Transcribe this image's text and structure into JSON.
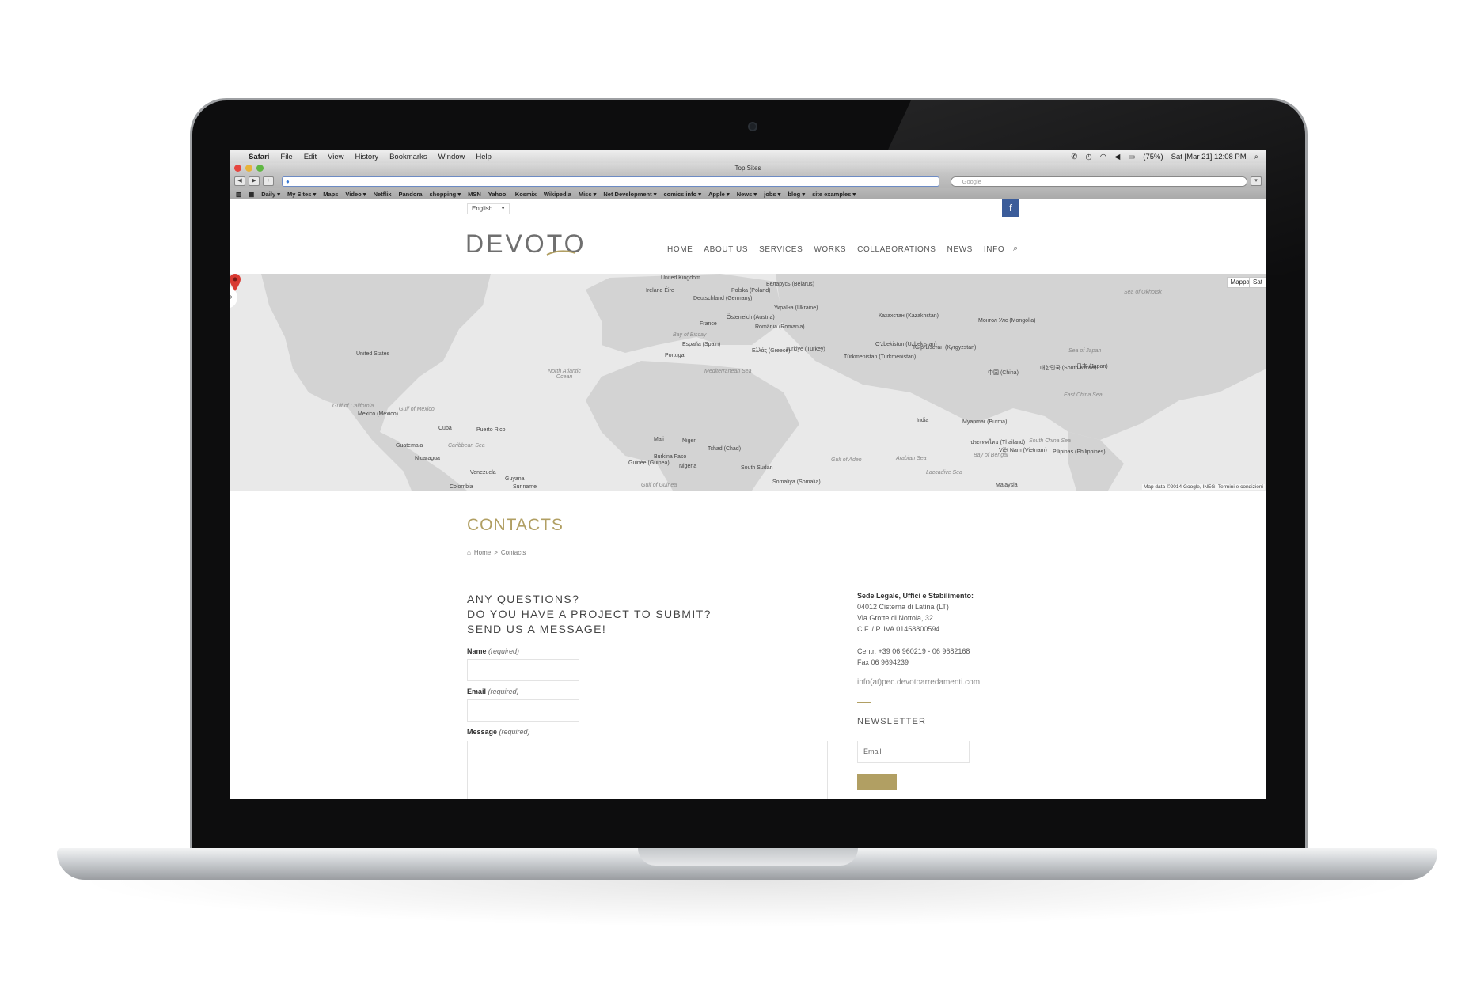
{
  "menubar": {
    "items": [
      "Safari",
      "File",
      "Edit",
      "View",
      "History",
      "Bookmarks",
      "Window",
      "Help"
    ],
    "battery": "(75%)",
    "clock": "Sat [Mar 21] 12:08 PM"
  },
  "safari": {
    "window_title": "Top Sites",
    "search_placeholder": "Google",
    "bookmarks": [
      "Daily ▾",
      "My Sites ▾",
      "Maps",
      "Video ▾",
      "Netflix",
      "Pandora",
      "shopping ▾",
      "MSN",
      "Yahoo!",
      "Kosmix",
      "Wikipedia",
      "Misc ▾",
      "Net Development ▾",
      "comics info ▾",
      "Apple ▾",
      "News ▾",
      "jobs ▾",
      "blog ▾",
      "site examples ▾"
    ]
  },
  "topbar": {
    "language": "English",
    "facebook_glyph": "f"
  },
  "header": {
    "logo": "DEVOTO",
    "nav": [
      "HOME",
      "ABOUT US",
      "SERVICES",
      "WORKS",
      "COLLABORATIONS",
      "NEWS",
      "INFO"
    ]
  },
  "map": {
    "map_button": "Mappa",
    "sat_button": "Sat",
    "attribution": "Map data ©2014 Google, INEGI  Termini e condizioni",
    "labels": [
      "United Kingdom",
      "Ireland Éire",
      "Deutschland (Germany)",
      "Polska (Poland)",
      "Беларусь (Belarus)",
      "Україна (Ukraine)",
      "France",
      "España (Spain)",
      "Portugal",
      "Österreich (Austria)",
      "România (Romania)",
      "Ελλάς (Greece)",
      "Türkiye (Turkey)",
      "Казахстан (Kazakhstan)",
      "Монгол Улс (Mongolia)",
      "O'zbekiston (Uzbekistan)",
      "Кыргызстан (Kyrgyzstan)",
      "Türkmenistan (Turkmenistan)",
      "中国 (China)",
      "대한민국 (South Korea)",
      "日本 (Japan)",
      "India",
      "Myanmar (Burma)",
      "ประเทศไทย (Thailand)",
      "Việt Nam (Vietnam)",
      "Pilipinas (Philippines)",
      "Malaysia",
      "United States",
      "Mexico (México)",
      "Cuba",
      "Guatemala",
      "Nicaragua",
      "Puerto Rico",
      "Venezuela",
      "Colombia",
      "Guyana",
      "Suriname",
      "Mali",
      "Niger",
      "Tchad (Chad)",
      "Nigeria",
      "Burkina Faso",
      "Guinée (Guinea)",
      "South Sudan",
      "Somaliya (Somalia)"
    ],
    "seas": [
      "North Atlantic Ocean",
      "Mediterranean Sea",
      "Gulf of California",
      "Gulf of Mexico",
      "Caribbean Sea",
      "Bay of Biscay",
      "Arabian Sea",
      "Bay of Bengal",
      "South China Sea",
      "Sea of Japan",
      "East China Sea",
      "Laccadive Sea",
      "Gulf of Guinea",
      "Gulf of Aden",
      "Sea of Okhotsk"
    ]
  },
  "page": {
    "title": "CONTACTS",
    "breadcrumb_home": "Home",
    "breadcrumb_sep": ">",
    "breadcrumb_current": "Contacts"
  },
  "form": {
    "heading_line1": "ANY QUESTIONS?",
    "heading_line2": "DO YOU HAVE A PROJECT TO SUBMIT?",
    "heading_line3": "SEND US A MESSAGE!",
    "name_label": "Name",
    "email_label": "Email",
    "message_label": "Message",
    "required": "(required)"
  },
  "address": {
    "heading": "Sede Legale, Uffici e Stabilimento:",
    "line1": "04012 Cisterna di Latina (LT)",
    "line2": "Via Grotte di Nottola, 32",
    "line3": "C.F. / P. IVA 01458800594",
    "phone": "Centr. +39 06 960219 - 06 9682168",
    "fax": "Fax 06 9694239",
    "email": "info(at)pec.devotoarredamenti.com"
  },
  "newsletter": {
    "title": "NEWSLETTER",
    "email_placeholder": "Email"
  },
  "colors": {
    "accent_gold": "#b19f63",
    "facebook_blue": "#3b5c9a",
    "map_land": "#d9d9d9"
  }
}
